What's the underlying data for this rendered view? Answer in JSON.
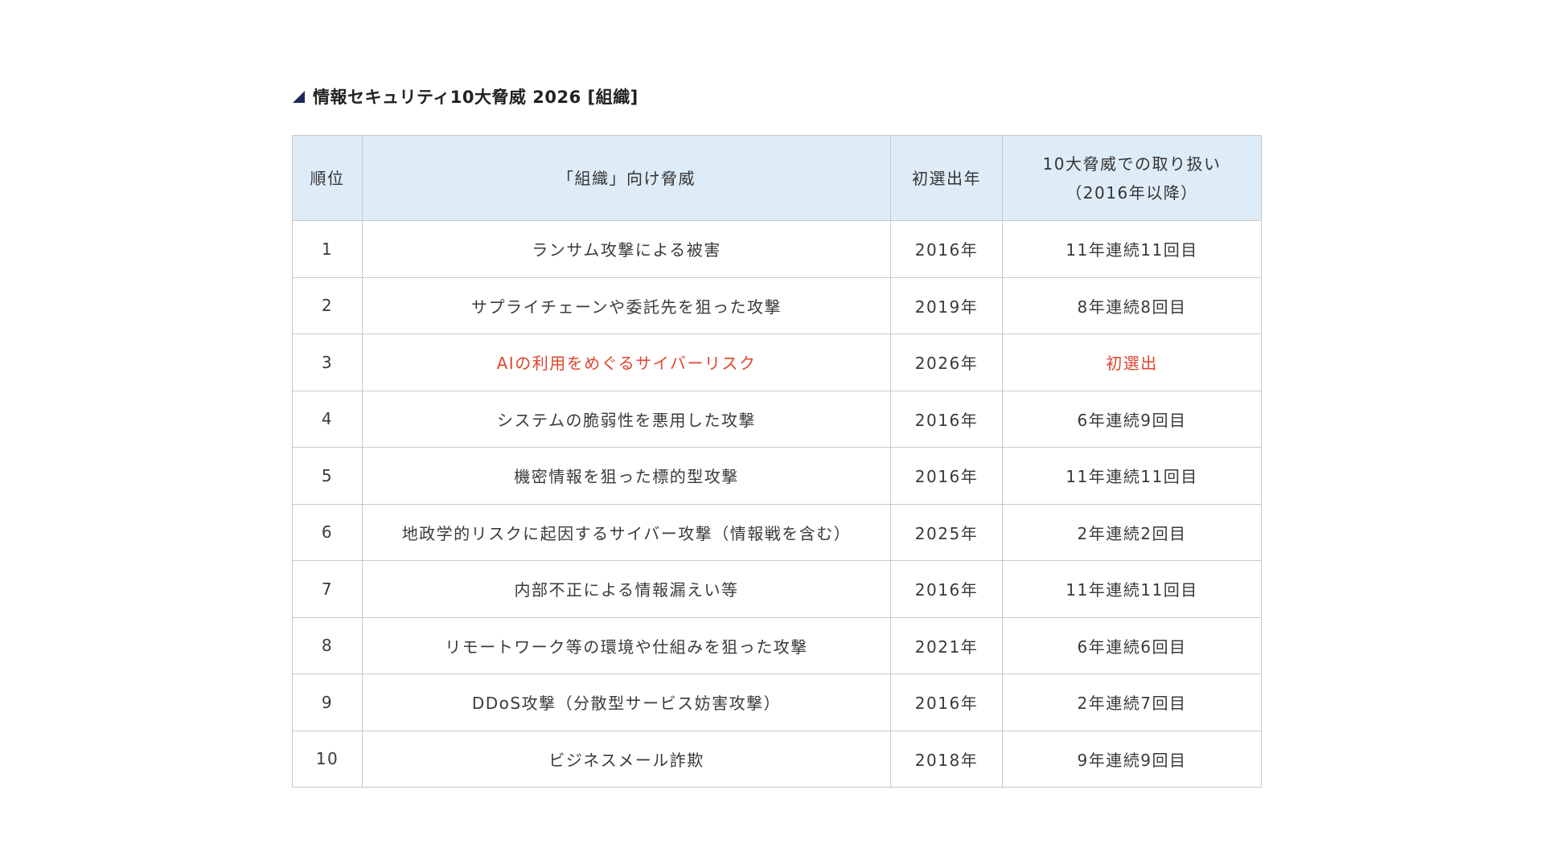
{
  "heading": {
    "title": "情報セキュリティ10大脅威 2026 [組織]"
  },
  "table": {
    "headers": {
      "rank": "順位",
      "threat": "「組織」向け脅威",
      "first_year": "初選出年",
      "history_line1": "10大脅威での取り扱い",
      "history_line2": "（2016年以降）"
    },
    "rows": [
      {
        "rank": "1",
        "threat": "ランサム攻撃による被害",
        "first_year": "2016年",
        "history": "11年連続11回目"
      },
      {
        "rank": "2",
        "threat": "サプライチェーンや委託先を狙った攻撃",
        "first_year": "2019年",
        "history": "8年連続8回目"
      },
      {
        "rank": "3",
        "threat": "AIの利用をめぐるサイバーリスク",
        "first_year": "2026年",
        "history": "初選出"
      },
      {
        "rank": "4",
        "threat": "システムの脆弱性を悪用した攻撃",
        "first_year": "2016年",
        "history": "6年連続9回目"
      },
      {
        "rank": "5",
        "threat": "機密情報を狙った標的型攻撃",
        "first_year": "2016年",
        "history": "11年連続11回目"
      },
      {
        "rank": "6",
        "threat": "地政学的リスクに起因するサイバー攻撃（情報戦を含む）",
        "first_year": "2025年",
        "history": "2年連続2回目"
      },
      {
        "rank": "7",
        "threat": "内部不正による情報漏えい等",
        "first_year": "2016年",
        "history": "11年連続11回目"
      },
      {
        "rank": "8",
        "threat": "リモートワーク等の環境や仕組みを狙った攻撃",
        "first_year": "2021年",
        "history": "6年連続6回目"
      },
      {
        "rank": "9",
        "threat": "DDoS攻撃（分散型サービス妨害攻撃）",
        "first_year": "2016年",
        "history": "2年連続7回目"
      },
      {
        "rank": "10",
        "threat": "ビジネスメール詐欺",
        "first_year": "2018年",
        "history": "9年連続9回目"
      }
    ]
  },
  "colors": {
    "header_bg": "#deecf8",
    "border": "#c9c9c9",
    "highlight_text": "#e0452d",
    "heading_marker": "#1f2a5a"
  },
  "icons": {
    "heading_marker": "triangle-marker-icon"
  }
}
